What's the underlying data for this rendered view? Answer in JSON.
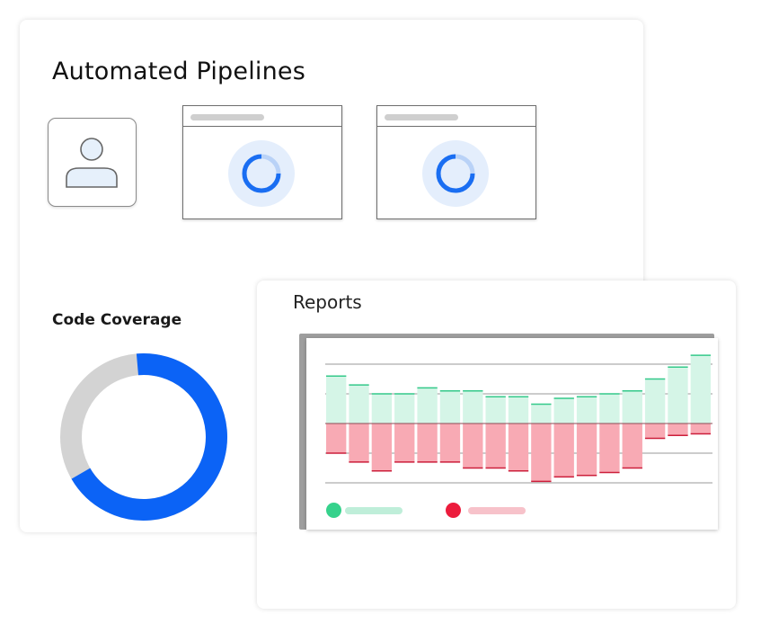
{
  "pipelines": {
    "title": "Automated Pipelines",
    "stages": [
      {
        "icon": "loading-spinner-icon"
      },
      {
        "icon": "loading-spinner-icon"
      }
    ],
    "user_icon": "user-icon"
  },
  "coverage": {
    "title": "Code Coverage",
    "covered_fraction": 0.68,
    "colors": {
      "covered": "#0b63f6",
      "uncovered": "#d3d3d3"
    }
  },
  "reports": {
    "title": "Reports",
    "legend": [
      {
        "color": "#36d28c",
        "line_color": "#bfeed9"
      },
      {
        "color": "#ec1c3c",
        "line_color": "#f7c2ca"
      }
    ]
  },
  "chart_data": {
    "type": "bar",
    "series": [
      {
        "values": [
          1.6,
          1.3,
          1.0,
          1.0,
          1.2,
          1.1,
          1.1,
          0.9,
          0.9,
          0.65,
          0.85,
          0.9,
          1.0,
          1.1,
          1.5,
          1.9,
          2.3
        ]
      },
      {
        "values": [
          -1.0,
          -1.3,
          -1.6,
          -1.3,
          -1.3,
          -1.3,
          -1.5,
          -1.5,
          -1.6,
          -1.95,
          -1.8,
          -1.75,
          -1.65,
          -1.5,
          -0.5,
          -0.4,
          -0.35
        ]
      }
    ],
    "colors": {
      "positive_fill": "#d5f5e7",
      "positive_edge": "#34c98a",
      "negative_fill": "#f8aab4",
      "negative_edge": "#cc1f3b"
    },
    "grid": true
  }
}
